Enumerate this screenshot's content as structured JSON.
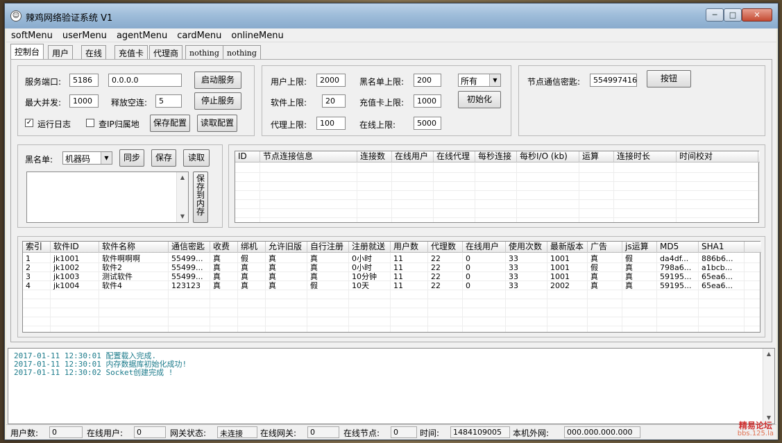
{
  "window": {
    "title": "辣鸡网络验证系统 V1",
    "min": "─",
    "max": "□",
    "close": "✕"
  },
  "menu": [
    "softMenu",
    "userMenu",
    "agentMenu",
    "cardMenu",
    "onlineMenu"
  ],
  "tabs": [
    "控制台",
    "用户",
    "在线",
    "充值卡",
    "代理商",
    "nothing",
    "nothing"
  ],
  "server": {
    "port_label": "服务端口:",
    "port": "5186",
    "ip": "0.0.0.0",
    "start_button": "启动服务",
    "max_conc_label": "最大并发:",
    "max_conc": "1000",
    "release_label": "释放空连:",
    "release": "5",
    "stop_button": "停止服务",
    "run_log_label": "运行日志",
    "run_log_checked": true,
    "ip_lookup_label": "查IP归属地",
    "ip_lookup_checked": false,
    "save_config": "保存配置",
    "load_config": "读取配置"
  },
  "limits": {
    "user_label": "用户上限:",
    "user": "2000",
    "blacklist_label": "黑名单上限:",
    "blacklist": "200",
    "scope": "所有",
    "soft_label": "软件上限:",
    "soft": "20",
    "card_label": "充值卡上限:",
    "card": "1000",
    "init_button": "初始化",
    "agent_label": "代理上限:",
    "agent": "100",
    "online_label": "在线上限:",
    "online": "5000"
  },
  "node": {
    "key_label": "节点通信密匙:",
    "key": "554997416",
    "button": "按钮"
  },
  "blacklist": {
    "label": "黑名单:",
    "type": "机器码",
    "sync": "同步",
    "save": "保存",
    "read": "读取",
    "save_mem": "保\n存\n到\n内\n存"
  },
  "node_table": {
    "headers": [
      "ID",
      "节点连接信息",
      "连接数",
      "在线用户",
      "在线代理",
      "每秒连接",
      "每秒I/O (kb)",
      "运算",
      "连接时长",
      "时间校对"
    ]
  },
  "soft_table": {
    "headers": [
      "索引",
      "软件ID",
      "软件名称",
      "通信密匙",
      "收费",
      "绑机",
      "允许旧版",
      "自行注册",
      "注册就送",
      "用户数",
      "代理数",
      "在线用户",
      "使用次数",
      "最新版本",
      "广告",
      "js运算",
      "MD5",
      "SHA1"
    ],
    "rows": [
      [
        "1",
        "jk1001",
        "软件啊啊啊",
        "55499...",
        "真",
        "假",
        "真",
        "真",
        "0小时",
        "11",
        "22",
        "0",
        "33",
        "1001",
        "真",
        "假",
        "da4df...",
        "886b6..."
      ],
      [
        "2",
        "jk1002",
        "软件2",
        "55499...",
        "真",
        "真",
        "真",
        "真",
        "0小时",
        "11",
        "22",
        "0",
        "33",
        "1001",
        "假",
        "真",
        "798a6...",
        "a1bcb..."
      ],
      [
        "3",
        "jk1003",
        "测试软件",
        "55499...",
        "真",
        "真",
        "真",
        "真",
        "10分钟",
        "11",
        "22",
        "0",
        "33",
        "1001",
        "真",
        "真",
        "59195...",
        "65ea6..."
      ],
      [
        "4",
        "jk1004",
        "软件4",
        "123123",
        "真",
        "真",
        "真",
        "假",
        "10天",
        "11",
        "22",
        "0",
        "33",
        "2002",
        "真",
        "真",
        "59195...",
        "65ea6..."
      ]
    ]
  },
  "log": [
    "2017-01-11 12:30:01  配置载入完成.",
    "2017-01-11 12:30:01  内存数据库初始化成功!",
    "2017-01-11 12:30:02  Socket创建完成 !"
  ],
  "status": {
    "users_label": "用户数:",
    "users": "0",
    "online_label": "在线用户:",
    "online": "0",
    "gw_label": "网关状态:",
    "gw": "未连接",
    "gw_online_label": "在线网关:",
    "gw_online": "0",
    "nodes_label": "在线节点:",
    "nodes": "0",
    "time_label": "时间:",
    "time": "1484109005",
    "ext_label": "本机外网:",
    "ext": "000.000.000.000"
  },
  "watermark": {
    "line1": "精易论坛",
    "line2": "bbs.125.la"
  }
}
